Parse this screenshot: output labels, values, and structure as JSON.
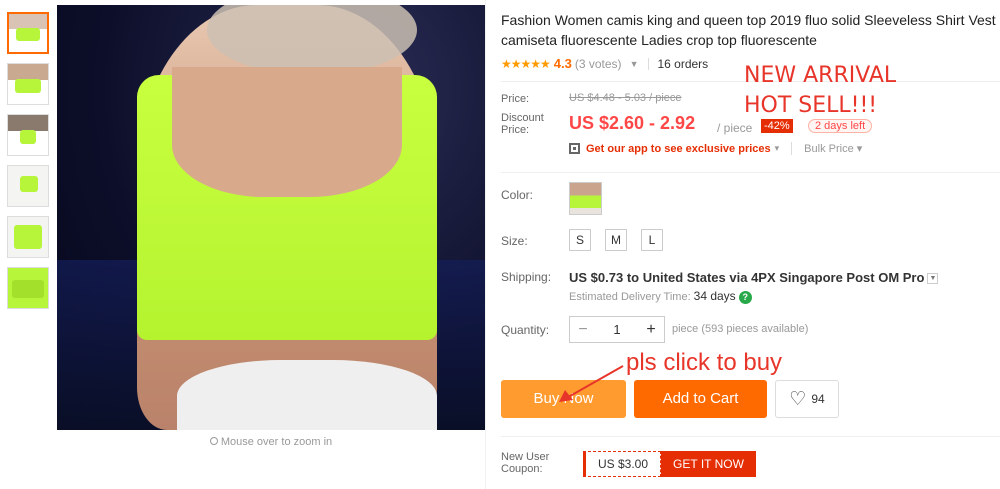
{
  "gallery": {
    "thumbnails": [
      "thumb-1",
      "thumb-2",
      "thumb-3",
      "thumb-4",
      "thumb-5",
      "thumb-6"
    ],
    "zoom_hint": "Mouse over to zoom in"
  },
  "product": {
    "title": "Fashion Women camis king and queen top 2019 fluo solid Sleeveless Shirt Vest camiseta fluorescente Ladies crop top fluorescente",
    "stars": "★★★★★",
    "rating": "4.3",
    "votes": "(3 votes)",
    "orders": "16 orders"
  },
  "price": {
    "price_label": "Price:",
    "old_price": "US $4.48 - 5.03 / piece",
    "discount_label": "Discount Price:",
    "discount_label_1": "Discount",
    "discount_label_2": "Price:",
    "discount_price": "US $2.60 - 2.92",
    "unit": "/ piece",
    "discount_badge": "-42%",
    "days_left": "2 days left",
    "app_promo": "Get our app to see exclusive prices",
    "app_chev": "▾",
    "bulk_price": "Bulk Price ▾"
  },
  "overlay": {
    "new_arrival": "NEW ARRIVAL",
    "hot_sell": "HOT SELL!!!",
    "click_to_buy": "pls click to buy"
  },
  "options": {
    "color_label": "Color:",
    "size_label": "Size:",
    "sizes": [
      "S",
      "M",
      "L"
    ],
    "shipping_label": "Shipping:",
    "shipping_text": "US $0.73 to United States via 4PX Singapore Post OM Pro",
    "delivery_label": "Estimated Delivery Time:",
    "delivery_days": "34 days",
    "quantity_label": "Quantity:",
    "quantity": "1",
    "minus": "−",
    "plus": "+",
    "pieces_available": "piece (593 pieces available)"
  },
  "actions": {
    "buy_now": "Buy Now",
    "add_to_cart": "Add to Cart",
    "wishlist_count": "94"
  },
  "coupon": {
    "label_1": "New User",
    "label_2": "Coupon:",
    "value": "US $3.00",
    "button": "GET IT NOW"
  },
  "colors": {
    "accent": "#ff6a00",
    "buy_button": "#ff9b2f",
    "price_red": "#ff4747",
    "overlay_red": "#e8352a",
    "neon_green": "#b7f53b"
  }
}
